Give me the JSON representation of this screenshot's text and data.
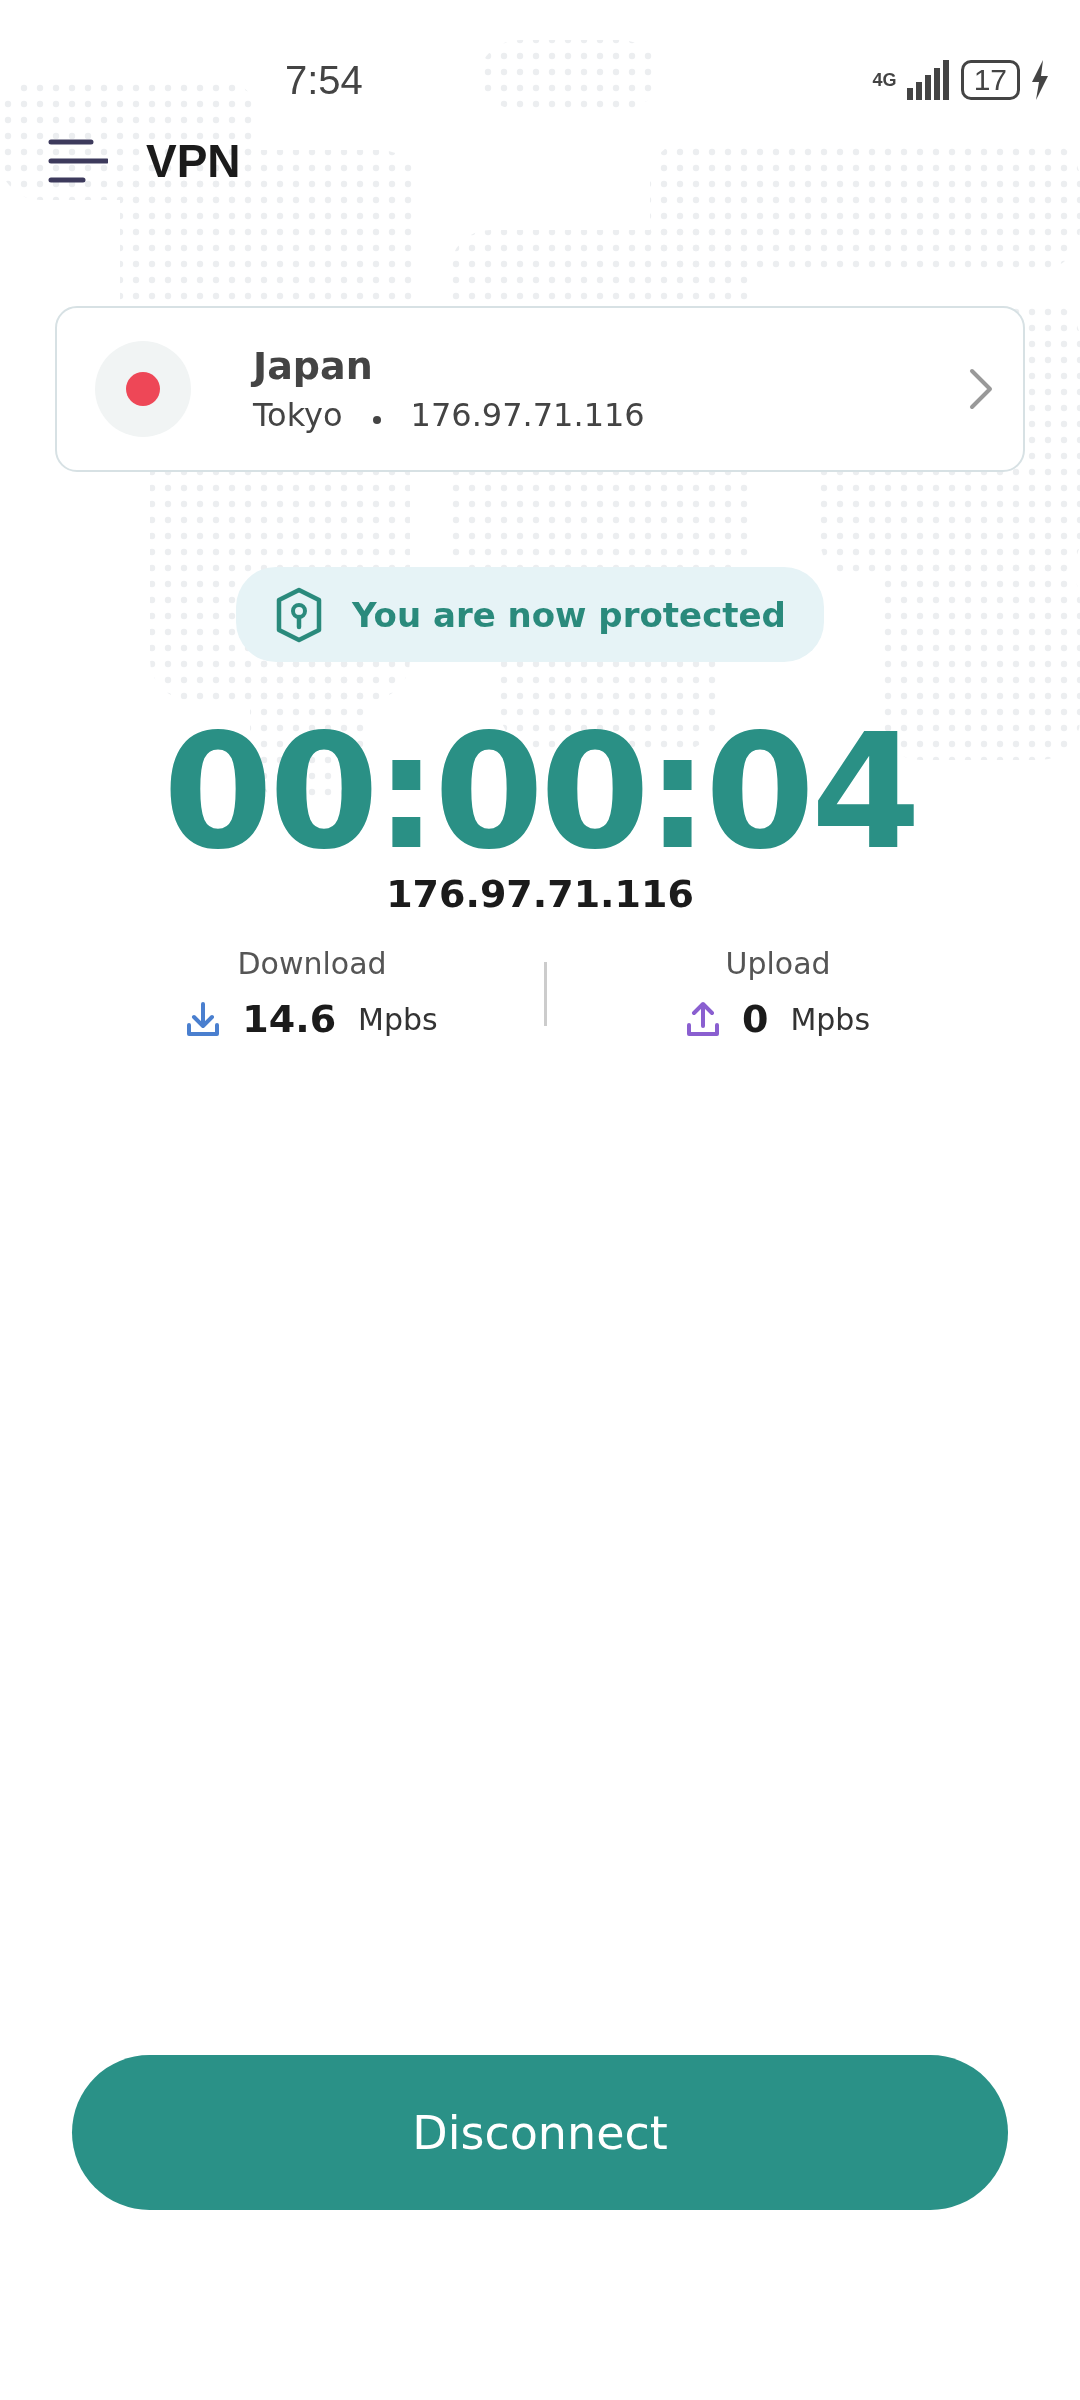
{
  "status_bar": {
    "time": "7:54",
    "network": "4G",
    "battery": "17"
  },
  "header": {
    "title": "VPN"
  },
  "server": {
    "country": "Japan",
    "city": "Tokyo",
    "ip": "176.97.71.116",
    "color": "#ee4757"
  },
  "status": {
    "text": "You are now protected"
  },
  "timer": "00:00:04",
  "ip": "176.97.71.116",
  "speeds": [
    {
      "kind": "download",
      "label": "Download",
      "value": "14.6",
      "unit": "Mpbs"
    },
    {
      "kind": "upload",
      "label": "Upload",
      "value": "0",
      "unit": "Mpbs"
    }
  ],
  "button": {
    "label": "Disconnect"
  }
}
